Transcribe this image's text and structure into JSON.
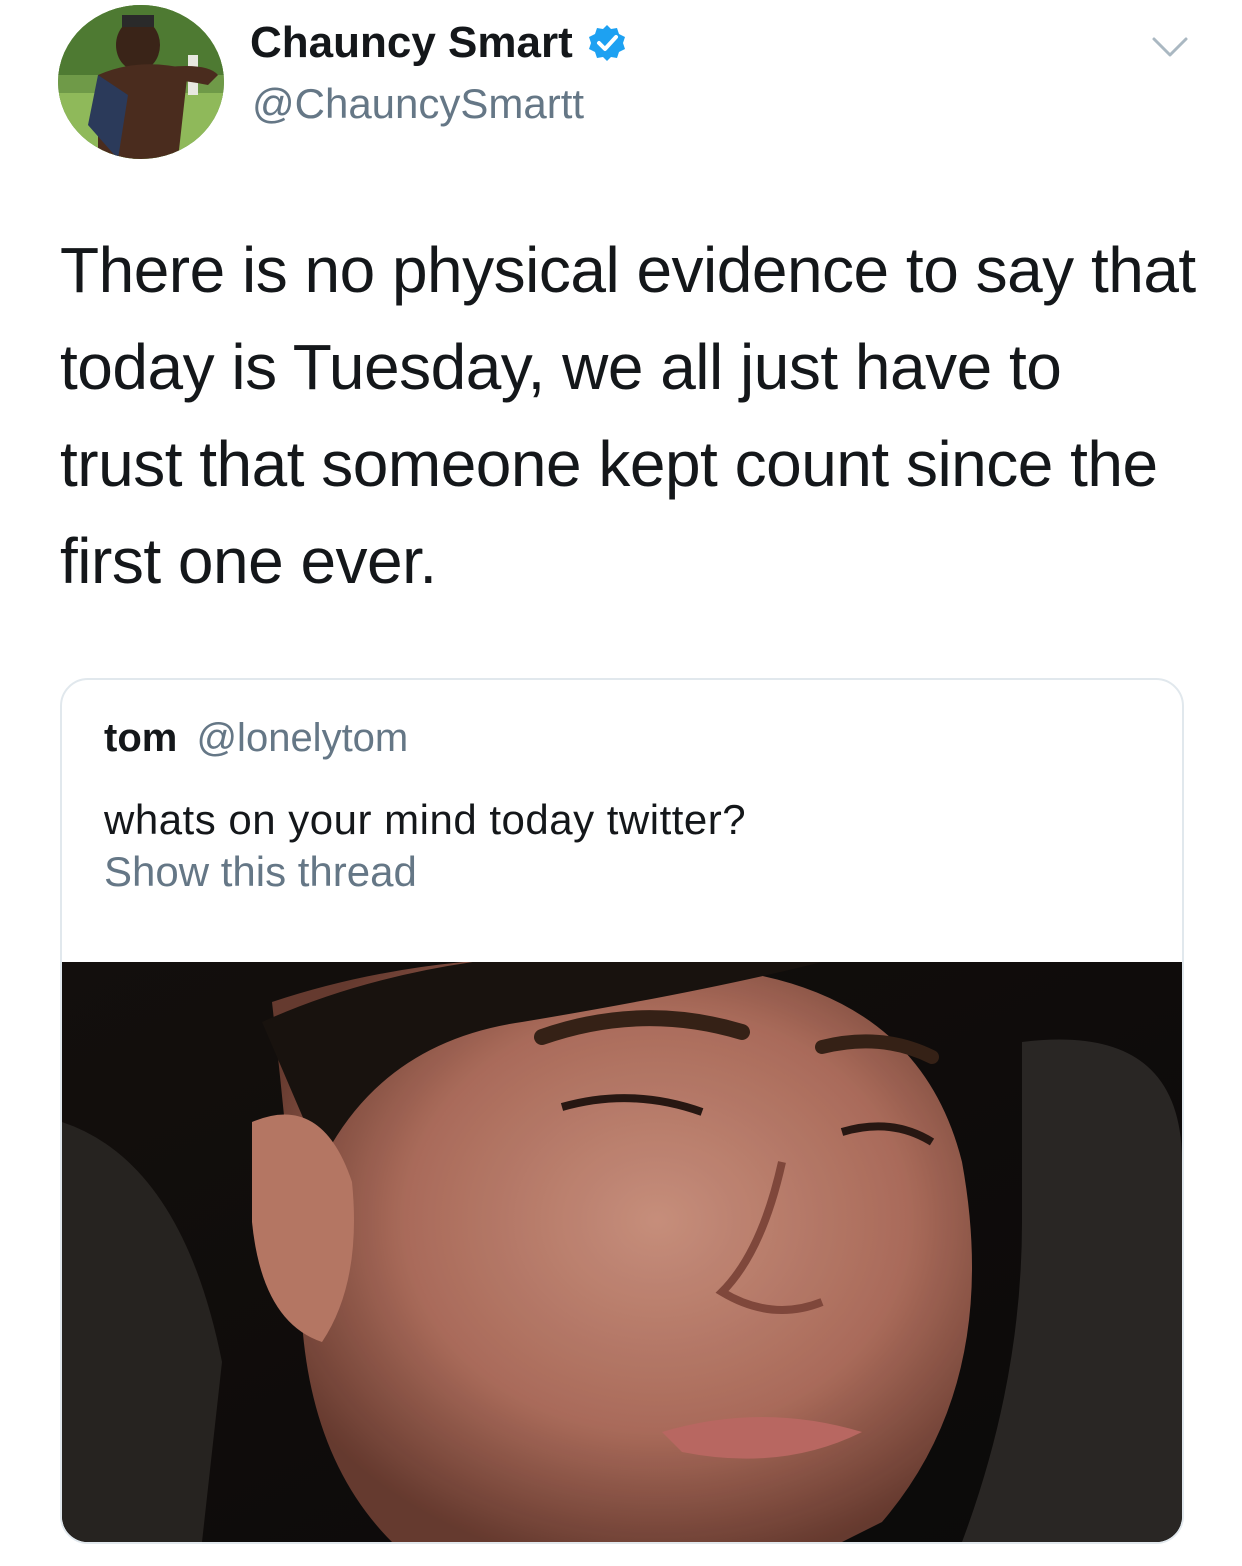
{
  "tweet": {
    "author": {
      "display_name": "Chauncy Smart",
      "handle": "@ChauncySmartt",
      "verified": true
    },
    "text": "There is no physical evidence to say that today is Tuesday, we all just have to trust that someone kept count since the first one ever.",
    "menu_icon": "chevron-down-icon"
  },
  "quoted_tweet": {
    "display_name": "tom",
    "handle": "@lonelytom",
    "text": "whats on your mind today twitter?",
    "show_thread_label": "Show this thread"
  },
  "colors": {
    "text_primary": "#14171a",
    "text_secondary": "#657786",
    "verified_blue": "#1da1f2",
    "card_border": "#e1e8ed"
  }
}
